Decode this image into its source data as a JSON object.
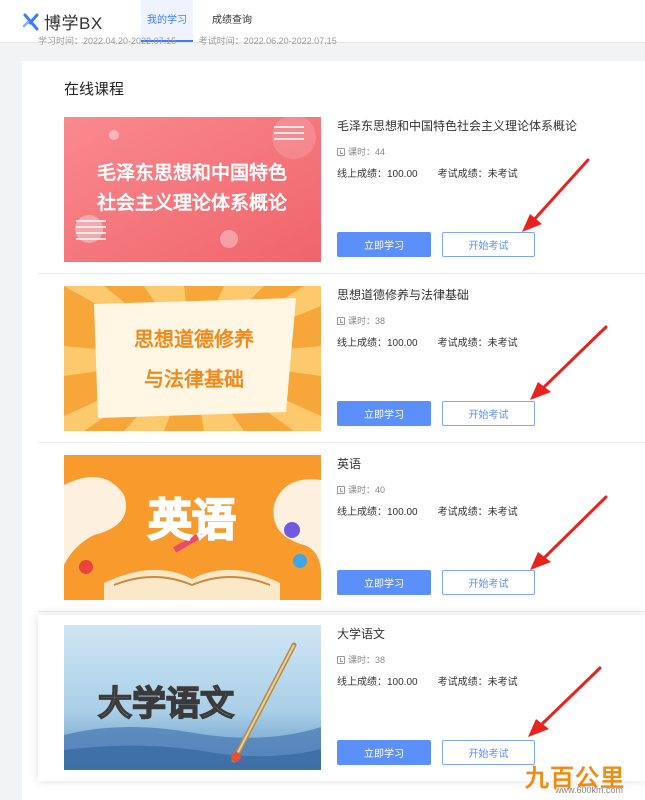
{
  "header": {
    "logo_text": "博学BX",
    "nav": [
      {
        "label": "我的学习",
        "active": true
      },
      {
        "label": "成绩查询",
        "active": false
      }
    ],
    "study_time_label": "学习时间：2022.04.20-2022.07.15",
    "exam_time_label": "考试时间：2022.06.20-2022.07.15"
  },
  "section_title": "在线课程",
  "courses": [
    {
      "title": "毛泽东思想和中国特色社会主义理论体系概论",
      "hours": "课时：44",
      "online_score": "线上成绩：100.00",
      "exam_score": "考试成绩：未考试",
      "study_button": "立即学习",
      "exam_button": "开始考试",
      "thumb_lines": [
        "毛泽东思想和中国特色",
        "社会主义理论体系概论"
      ]
    },
    {
      "title": "思想道德修养与法律基础",
      "hours": "课时：38",
      "online_score": "线上成绩：100.00",
      "exam_score": "考试成绩：未考试",
      "study_button": "立即学习",
      "exam_button": "开始考试",
      "thumb_lines": [
        "思想道德修养",
        "与法律基础"
      ]
    },
    {
      "title": "英语",
      "hours": "课时：40",
      "online_score": "线上成绩：100.00",
      "exam_score": "考试成绩：未考试",
      "study_button": "立即学习",
      "exam_button": "开始考试",
      "thumb_lines": [
        "英语"
      ]
    },
    {
      "title": "大学语文",
      "hours": "课时：38",
      "online_score": "线上成绩：100.00",
      "exam_score": "考试成绩：未考试",
      "study_button": "立即学习",
      "exam_button": "开始考试",
      "thumb_lines": [
        "大学语文"
      ]
    }
  ],
  "watermark": {
    "text": "九百公里",
    "url": "www.600km.com"
  },
  "colors": {
    "primary": "#5b8ff9",
    "annotation_arrow": "#e8231f",
    "nav_active": "#3c7cff"
  }
}
